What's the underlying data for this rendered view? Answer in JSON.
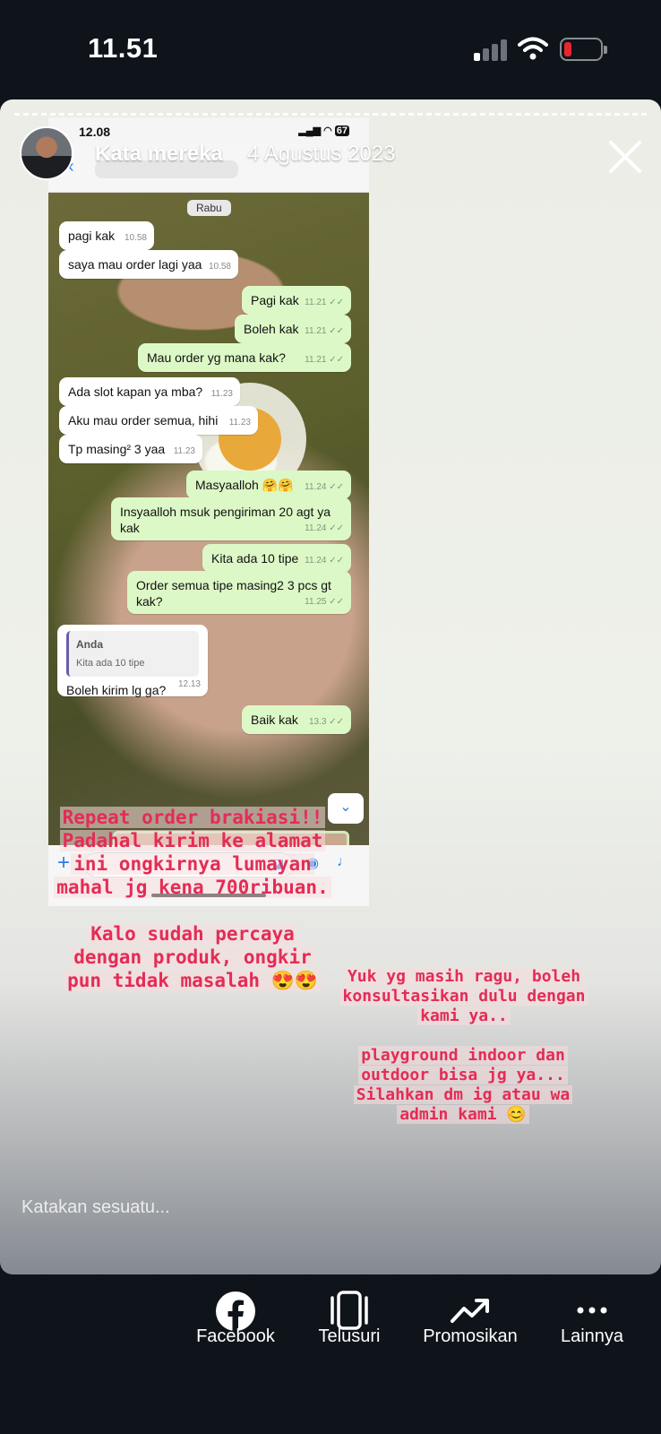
{
  "status": {
    "time": "11.51"
  },
  "story": {
    "author": "Kata mereka",
    "date": "4 Agustus 2023",
    "reply_placeholder": "Katakan sesuatu..."
  },
  "embedded_chat": {
    "status_time": "12.08",
    "status_battery": "67",
    "day_label": "Rabu",
    "messages": [
      {
        "dir": "in",
        "text": "pagi kak",
        "time": "10.58"
      },
      {
        "dir": "in",
        "text": "saya mau order lagi yaa",
        "time": "10.58"
      },
      {
        "dir": "out",
        "text": "Pagi kak",
        "time": "11.21"
      },
      {
        "dir": "out",
        "text": "Boleh kak",
        "time": "11.21"
      },
      {
        "dir": "out",
        "text": "Mau order yg mana kak?",
        "time": "11.21"
      },
      {
        "dir": "in",
        "text": "Ada slot kapan ya mba?",
        "time": "11.23"
      },
      {
        "dir": "in",
        "text": "Aku mau order semua, hihi",
        "time": "11.23"
      },
      {
        "dir": "in",
        "text": "Tp masing² 3 yaa",
        "time": "11.23"
      },
      {
        "dir": "out",
        "text": "Masyaalloh 🤗🤗",
        "time": "11.24"
      },
      {
        "dir": "out",
        "text": "Insyaalloh msuk pengiriman 20 agt ya kak",
        "time": "11.24"
      },
      {
        "dir": "out",
        "text": "Kita ada 10 tipe",
        "time": "11.24"
      },
      {
        "dir": "out",
        "text": "Order semua tipe masing2 3 pcs gt kak?",
        "time": "11.25"
      },
      {
        "dir": "in",
        "text": "Boleh kirim lg ga?",
        "time": "12.13",
        "quote_name": "Anda",
        "quote_text": "Kita ada 10 tipe"
      },
      {
        "dir": "out",
        "text": "Baik kak",
        "time": "13.3"
      }
    ]
  },
  "captions": {
    "left_1": "Repeat order brakiasi!! Padahal kirim ke alamat ini ongkirnya lumayan mahal jg kena 700ribuan.",
    "left_2": "Kalo sudah percaya dengan produk, ongkir pun tidak masalah 😍😍",
    "right_1": "Yuk yg masih ragu, boleh konsultasikan dulu dengan kami ya..",
    "right_2": "playground indoor dan outdoor bisa jg ya... Silahkan dm ig atau wa admin kami 😊"
  },
  "actions": [
    {
      "label": "Facebook",
      "icon": "facebook-icon"
    },
    {
      "label": "Telusuri",
      "icon": "phone-browse-icon"
    },
    {
      "label": "Promosikan",
      "icon": "trending-up-icon"
    },
    {
      "label": "Lainnya",
      "icon": "more-icon"
    }
  ],
  "colors": {
    "caption": "#e42c55",
    "bubble_out": "#dcf8c6",
    "background": "#0f141b"
  }
}
